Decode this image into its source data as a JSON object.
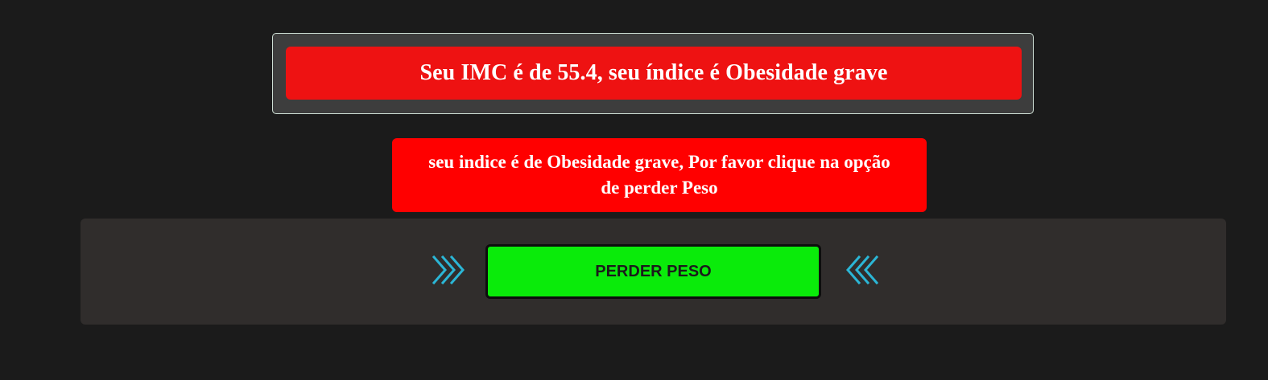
{
  "result": {
    "text": "Seu IMC é de 55.4, seu índice é Obesidade grave"
  },
  "message": {
    "text": "seu indice é de Obesidade grave, Por favor clique na opção de perder Peso"
  },
  "action": {
    "button_label": "PERDER PESO",
    "left_icon": "chevrons-right-icon",
    "right_icon": "chevrons-left-icon"
  },
  "colors": {
    "background": "#1b1b1b",
    "result_panel": "#3d3d3d",
    "result_banner": "#ee1212",
    "message_box": "#ff0000",
    "action_area": "#302d2c",
    "button": "#0aeb0a",
    "chevron": "#2bb6d6"
  }
}
